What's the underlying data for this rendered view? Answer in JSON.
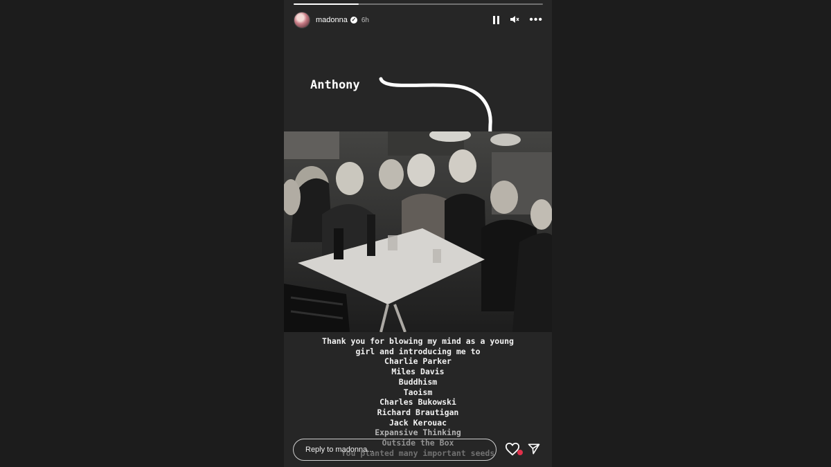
{
  "story": {
    "progress": 0.26,
    "user": {
      "username": "madonna",
      "verified": true,
      "time": "6h"
    },
    "icons": {
      "pause": "pause-icon",
      "mute": "mute-icon",
      "more": "more-icon",
      "verified": "verified-badge-icon",
      "heart": "heart-icon",
      "send": "send-icon"
    },
    "annotation": {
      "label": "Anthony"
    },
    "caption": {
      "lines": [
        "Thank you for blowing my mind as a young",
        "girl and introducing me to",
        "Charlie Parker",
        "Miles Davis",
        "Buddhism",
        "Taoism",
        "Charles Bukowski",
        "Richard Brautigan",
        "Jack Kerouac",
        "Expansive Thinking",
        "Outside the Box",
        "You planted many important seeds"
      ]
    },
    "reply": {
      "placeholder": "Reply to madonna..."
    },
    "colors": {
      "background": "#262626",
      "page": "#1c1c1c",
      "like_dot": "#e0304a"
    }
  }
}
